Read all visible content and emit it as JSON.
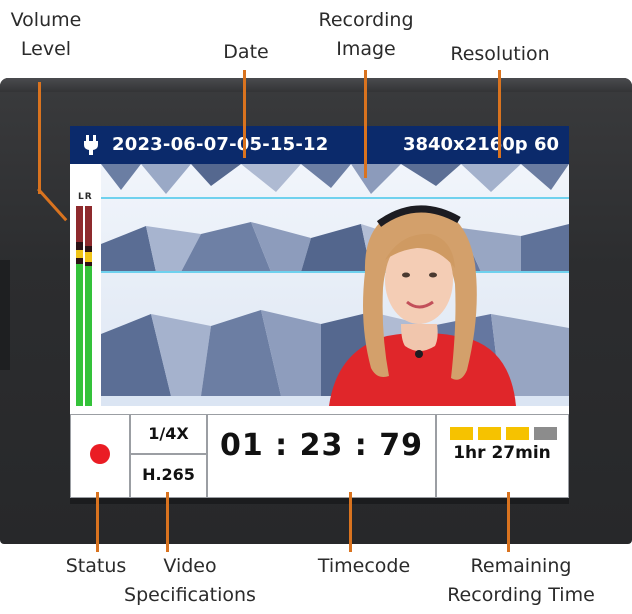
{
  "callouts": {
    "volume_level": [
      "Volume",
      "Level"
    ],
    "date": "Date",
    "recording_image": [
      "Recording",
      "Image"
    ],
    "resolution": "Resolution",
    "status": "Status",
    "video_specifications": [
      "Video",
      "Specifications"
    ],
    "timecode": "Timecode",
    "remaining_recording_time": [
      "Remaining",
      "Recording Time"
    ]
  },
  "screen": {
    "date": "2023-06-07-05-15-12",
    "resolution": "3840x2160p 60",
    "power_icon": "plug-icon",
    "meter_channels": "LR",
    "status_indicator_color": "#ea1c24",
    "speed": "1/4X",
    "codec": "H.265",
    "timecode": "01 : 23 : 79",
    "remaining_time": "1hr 27min",
    "remaining_blocks": [
      {
        "color": "#f6c200"
      },
      {
        "color": "#f6c200"
      },
      {
        "color": "#f6c200"
      },
      {
        "color": "#8c8c8c"
      }
    ]
  },
  "colors": {
    "header_bar": "#0b2a6b",
    "leader_lines": "#d9731f",
    "meter_green": "#34c23a",
    "meter_yellow": "#f0c419",
    "meter_red": "#8e2a2d"
  }
}
